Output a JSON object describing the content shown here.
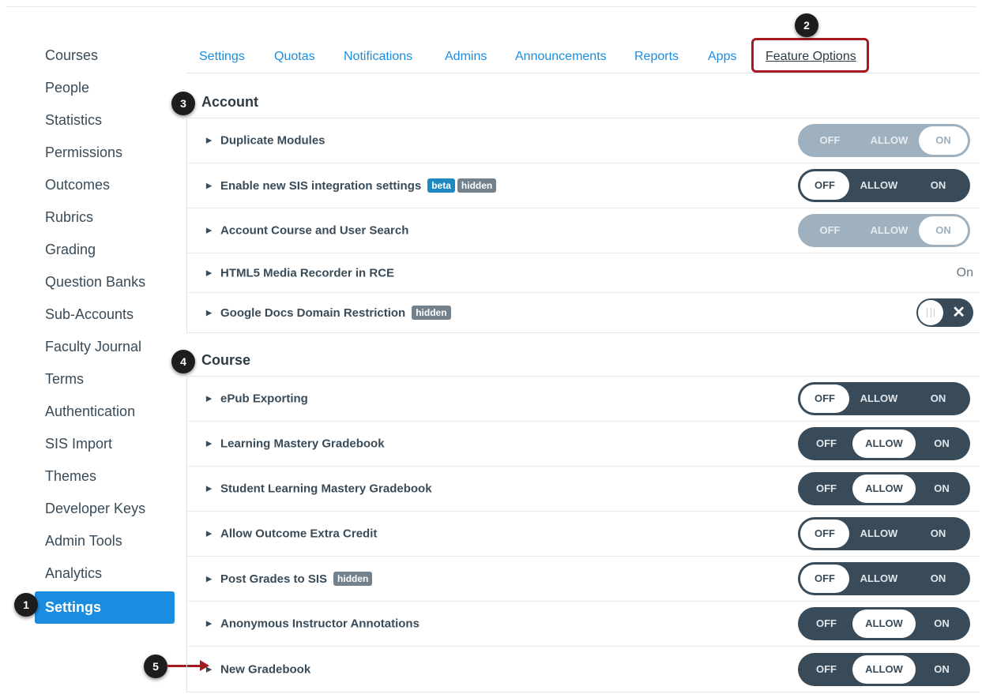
{
  "sidebar": {
    "items": [
      {
        "label": "Courses"
      },
      {
        "label": "People"
      },
      {
        "label": "Statistics"
      },
      {
        "label": "Permissions"
      },
      {
        "label": "Outcomes"
      },
      {
        "label": "Rubrics"
      },
      {
        "label": "Grading"
      },
      {
        "label": "Question Banks"
      },
      {
        "label": "Sub-Accounts"
      },
      {
        "label": "Faculty Journal"
      },
      {
        "label": "Terms"
      },
      {
        "label": "Authentication"
      },
      {
        "label": "SIS Import"
      },
      {
        "label": "Themes"
      },
      {
        "label": "Developer Keys"
      },
      {
        "label": "Admin Tools"
      },
      {
        "label": "Analytics"
      },
      {
        "label": "Settings",
        "active": true
      }
    ]
  },
  "tabs": [
    {
      "label": "Settings"
    },
    {
      "label": "Quotas"
    },
    {
      "label": "Notifications"
    },
    {
      "label": "Admins"
    },
    {
      "label": "Announcements"
    },
    {
      "label": "Reports"
    },
    {
      "label": "Apps"
    },
    {
      "label": "Feature Options",
      "current": true
    }
  ],
  "callouts": [
    "1",
    "2",
    "3",
    "4",
    "5"
  ],
  "toggle_labels": {
    "off": "OFF",
    "allow": "ALLOW",
    "on": "ON"
  },
  "account": {
    "title": "Account",
    "features": [
      {
        "label": "Duplicate Modules",
        "control": "tri",
        "state": "on",
        "disabled": true
      },
      {
        "label": "Enable new SIS integration settings",
        "tags": [
          "beta",
          "hidden"
        ],
        "control": "tri",
        "state": "off"
      },
      {
        "label": "Account Course and User Search",
        "control": "tri",
        "state": "on",
        "disabled": true
      },
      {
        "label": "HTML5 Media Recorder in RCE",
        "control": "text",
        "value": "On"
      },
      {
        "label": "Google Docs Domain Restriction",
        "tags": [
          "hidden"
        ],
        "control": "binary",
        "state": "off"
      }
    ]
  },
  "course": {
    "title": "Course",
    "features": [
      {
        "label": "ePub Exporting",
        "control": "tri",
        "state": "off"
      },
      {
        "label": "Learning Mastery Gradebook",
        "control": "tri",
        "state": "allow"
      },
      {
        "label": "Student Learning Mastery Gradebook",
        "control": "tri",
        "state": "allow"
      },
      {
        "label": "Allow Outcome Extra Credit",
        "control": "tri",
        "state": "off"
      },
      {
        "label": "Post Grades to SIS",
        "tags": [
          "hidden"
        ],
        "control": "tri",
        "state": "off"
      },
      {
        "label": "Anonymous Instructor Annotations",
        "control": "tri",
        "state": "allow"
      },
      {
        "label": "New Gradebook",
        "control": "tri",
        "state": "allow"
      }
    ]
  },
  "colors": {
    "accent": "#1b8de0",
    "toggle_dark": "#394b58",
    "toggle_disabled": "#9fb0be",
    "highlight_red": "#a61b1f",
    "beta_tag": "#1e88c2",
    "hidden_tag": "#73818c"
  }
}
